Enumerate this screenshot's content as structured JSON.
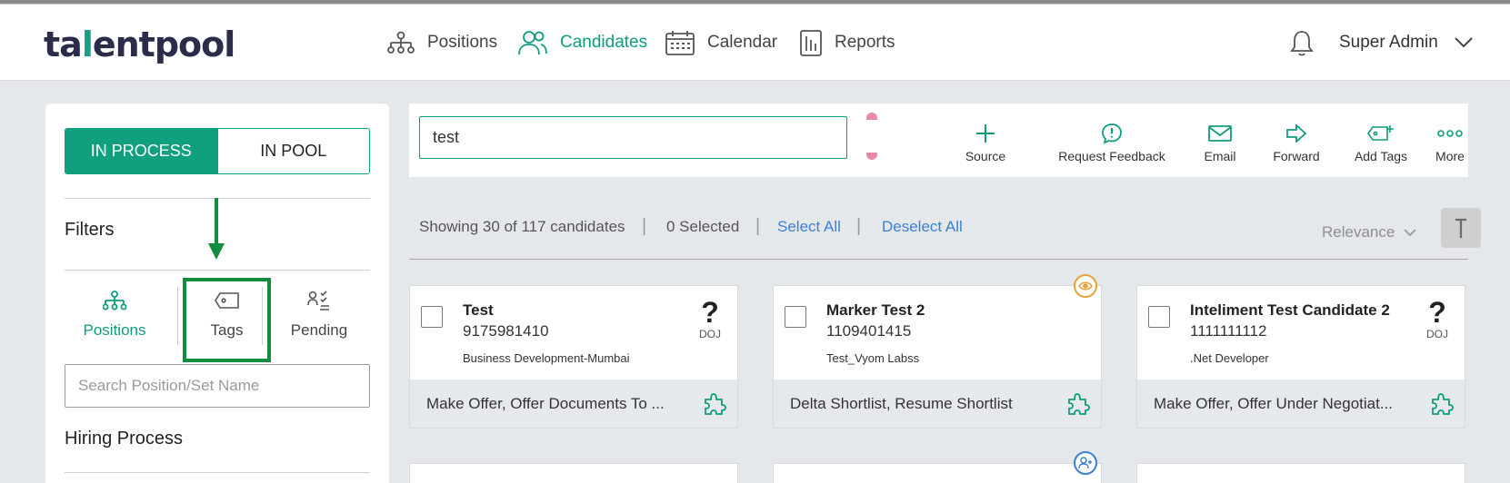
{
  "header": {
    "logo": {
      "part1": "ta",
      "part2": "l",
      "part3": "entpool"
    },
    "nav": [
      {
        "label": "Positions",
        "icon": "org-chart-icon"
      },
      {
        "label": "Candidates",
        "icon": "users-icon"
      },
      {
        "label": "Calendar",
        "icon": "calendar-icon"
      },
      {
        "label": "Reports",
        "icon": "report-icon"
      }
    ],
    "active_nav": "Candidates",
    "user_name": "Super Admin"
  },
  "left_panel": {
    "toggle": {
      "in_process": "IN PROCESS",
      "in_pool": "IN POOL"
    },
    "filters_title": "Filters",
    "filter_tabs": [
      {
        "label": "Positions",
        "icon": "org-chart-icon"
      },
      {
        "label": "Tags",
        "icon": "tag-icon"
      },
      {
        "label": "Pending",
        "icon": "pending-checklist-icon"
      }
    ],
    "position_search_placeholder": "Search Position/Set Name",
    "hiring_process_title": "Hiring Process"
  },
  "toolbar": {
    "search_value": "test",
    "actions": [
      {
        "label": "Source",
        "icon": "plus-icon"
      },
      {
        "label": "Request Feedback",
        "icon": "feedback-icon"
      },
      {
        "label": "Email",
        "icon": "email-icon"
      },
      {
        "label": "Forward",
        "icon": "forward-icon"
      },
      {
        "label": "Add Tags",
        "icon": "add-tag-icon"
      },
      {
        "label": "More",
        "icon": "more-dots-icon"
      }
    ]
  },
  "results": {
    "showing": "Showing 30 of 117 candidates",
    "selected": "0 Selected",
    "select_all": "Select All",
    "deselect_all": "Deselect All",
    "sort": "Relevance"
  },
  "candidates": [
    {
      "name": "Test",
      "phone": "9175981410",
      "position": "Business Development-Mumbai",
      "status": "Make Offer, Offer Documents To ...",
      "doj": "DOJ"
    },
    {
      "name": "Marker Test 2",
      "phone": "1109401415",
      "position": "Test_Vyom Labss",
      "status": "Delta Shortlist, Resume Shortlist"
    },
    {
      "name": "Inteliment Test Candidate 2",
      "phone": "1111111112",
      "position": ".Net Developer",
      "status": "Make Offer, Offer Under Negotiat...",
      "doj": "DOJ"
    }
  ],
  "colors": {
    "brand": "#0f9d7f",
    "highlight": "#128c3d",
    "link": "#3b80d6",
    "badge_orange": "#e8a33a",
    "badge_blue": "#3b80d6"
  }
}
